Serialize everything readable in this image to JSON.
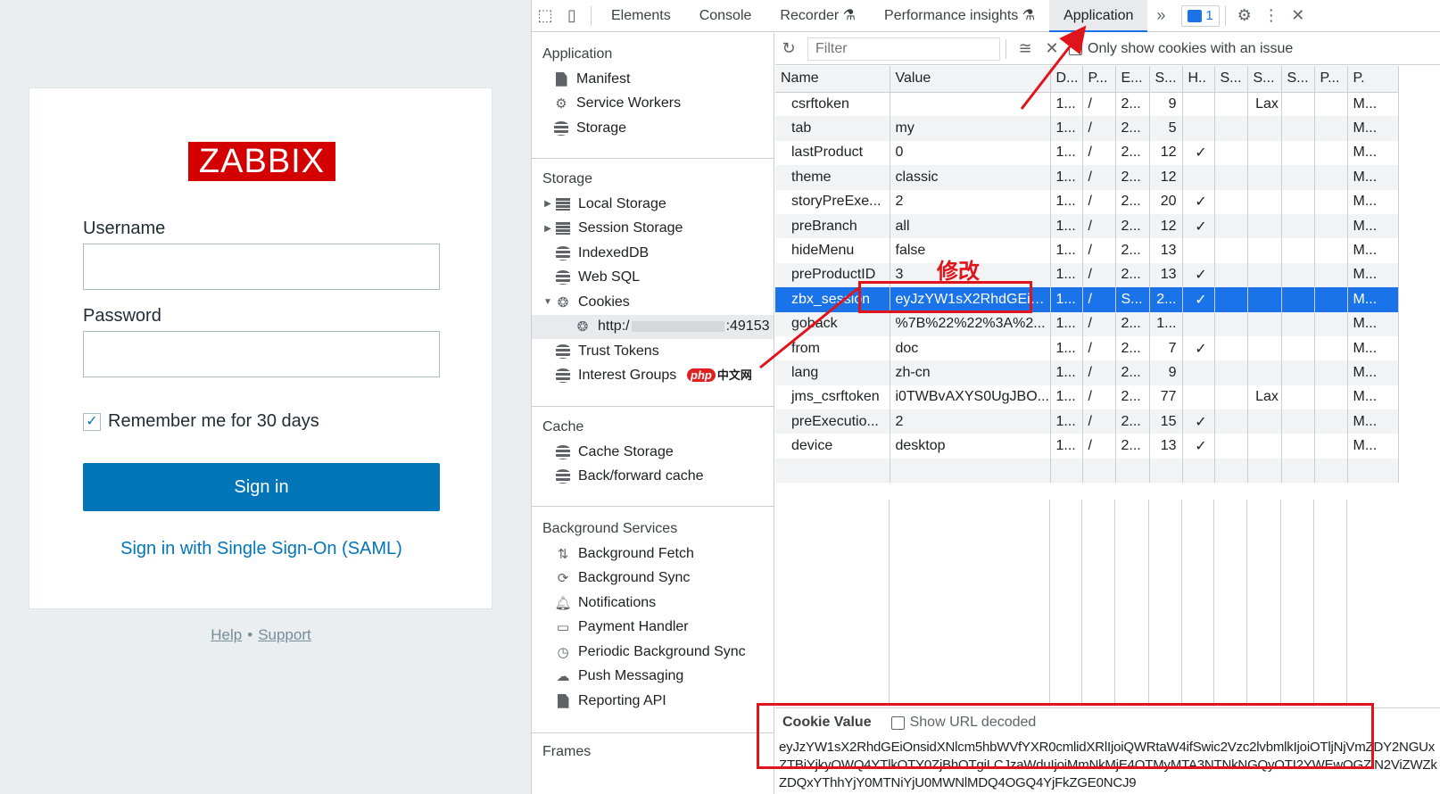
{
  "login": {
    "logo": "ZABBIX",
    "username_label": "Username",
    "username_value": "",
    "password_label": "Password",
    "password_value": "",
    "remember_label": "Remember me for 30 days",
    "remember_checked": true,
    "signin_label": "Sign in",
    "sso_label": "Sign in with Single Sign-On (SAML)",
    "footer_help": "Help",
    "footer_sep": "•",
    "footer_support": "Support"
  },
  "devtools": {
    "tabs": [
      "Elements",
      "Console",
      "Recorder",
      "Performance insights",
      "Application"
    ],
    "active_tab": "Application",
    "more_tabs": "»",
    "issues_count": "1",
    "sidebar": {
      "application_title": "Application",
      "application_items": [
        "Manifest",
        "Service Workers",
        "Storage"
      ],
      "storage_title": "Storage",
      "storage_items": [
        "Local Storage",
        "Session Storage",
        "IndexedDB",
        "Web SQL",
        "Cookies"
      ],
      "cookie_origin": "http:/",
      "cookie_origin_port": ":49153",
      "storage_items_2": [
        "Trust Tokens",
        "Interest Groups"
      ],
      "cache_title": "Cache",
      "cache_items": [
        "Cache Storage",
        "Back/forward cache"
      ],
      "bg_title": "Background Services",
      "bg_items": [
        "Background Fetch",
        "Background Sync",
        "Notifications",
        "Payment Handler",
        "Periodic Background Sync",
        "Push Messaging",
        "Reporting API"
      ],
      "frames_title": "Frames",
      "watermark_php": "php",
      "watermark_text": "中文网"
    },
    "cookies": {
      "filter_placeholder": "Filter",
      "only_issues_label": "Only show cookies with an issue",
      "columns": [
        "Name",
        "Value",
        "D...",
        "P...",
        "E...",
        "S...",
        "H..",
        "S...",
        "S...",
        "S...",
        "P...",
        "P."
      ],
      "rows": [
        [
          "csrftoken",
          "",
          "1...",
          "/",
          "2...",
          "9",
          "",
          "",
          "Lax",
          "",
          "",
          "M..."
        ],
        [
          "tab",
          "my",
          "1...",
          "/",
          "2...",
          "5",
          "",
          "",
          "",
          "",
          "",
          "M..."
        ],
        [
          "lastProduct",
          "0",
          "1...",
          "/",
          "2...",
          "12",
          "✓",
          "",
          "",
          "",
          "",
          "M..."
        ],
        [
          "theme",
          "classic",
          "1...",
          "/",
          "2...",
          "12",
          "",
          "",
          "",
          "",
          "",
          "M..."
        ],
        [
          "storyPreExe...",
          "2",
          "1...",
          "/",
          "2...",
          "20",
          "✓",
          "",
          "",
          "",
          "",
          "M..."
        ],
        [
          "preBranch",
          "all",
          "1...",
          "/",
          "2...",
          "12",
          "✓",
          "",
          "",
          "",
          "",
          "M..."
        ],
        [
          "hideMenu",
          "false",
          "1...",
          "/",
          "2...",
          "13",
          "",
          "",
          "",
          "",
          "",
          "M..."
        ],
        [
          "preProductID",
          "3",
          "1...",
          "/",
          "2...",
          "13",
          "✓",
          "",
          "",
          "",
          "",
          "M..."
        ],
        [
          "zbx_session",
          "eyJzYW1sX2RhdGEiO...",
          "1...",
          "/",
          "S...",
          "2...",
          "✓",
          "",
          "",
          "",
          "",
          "M..."
        ],
        [
          "goback",
          "%7B%22%22%3A%2...",
          "1...",
          "/",
          "2...",
          "1...",
          "",
          "",
          "",
          "",
          "",
          "M..."
        ],
        [
          "from",
          "doc",
          "1...",
          "/",
          "2...",
          "7",
          "✓",
          "",
          "",
          "",
          "",
          "M..."
        ],
        [
          "lang",
          "zh-cn",
          "1...",
          "/",
          "2...",
          "9",
          "",
          "",
          "",
          "",
          "",
          "M..."
        ],
        [
          "jms_csrftoken",
          "i0TWBvAXYS0UgJBO...",
          "1...",
          "/",
          "2...",
          "77",
          "",
          "",
          "Lax",
          "",
          "",
          "M..."
        ],
        [
          "preExecutio...",
          "2",
          "1...",
          "/",
          "2...",
          "15",
          "✓",
          "",
          "",
          "",
          "",
          "M..."
        ],
        [
          "device",
          "desktop",
          "1...",
          "/",
          "2...",
          "13",
          "✓",
          "",
          "",
          "",
          "",
          "M..."
        ]
      ],
      "selected_row": 8,
      "cookie_value_title": "Cookie Value",
      "show_decoded_label": "Show URL decoded",
      "cookie_value": "eyJzYW1sX2RhdGEiOnsidXNlcm5hbWVfYXR0cmlidXRlIjoiQWRtaW4ifSwic2Vzc2lvbmlkIjoiOTljNjVmZDY2NGUxZTBiYjkyOWQ4YTlkOTY0ZjBhOTgiLCJzaWduIjoiMmNkMjE4OTMyMTA3NTNkNGQyOTI2YWEwOGZlN2ViZWZkZDQxYThhYjY0MTNiYjU0MWNlMDQ4OGQ4YjFkZGE0NCJ9"
    },
    "annotation": "修改"
  }
}
